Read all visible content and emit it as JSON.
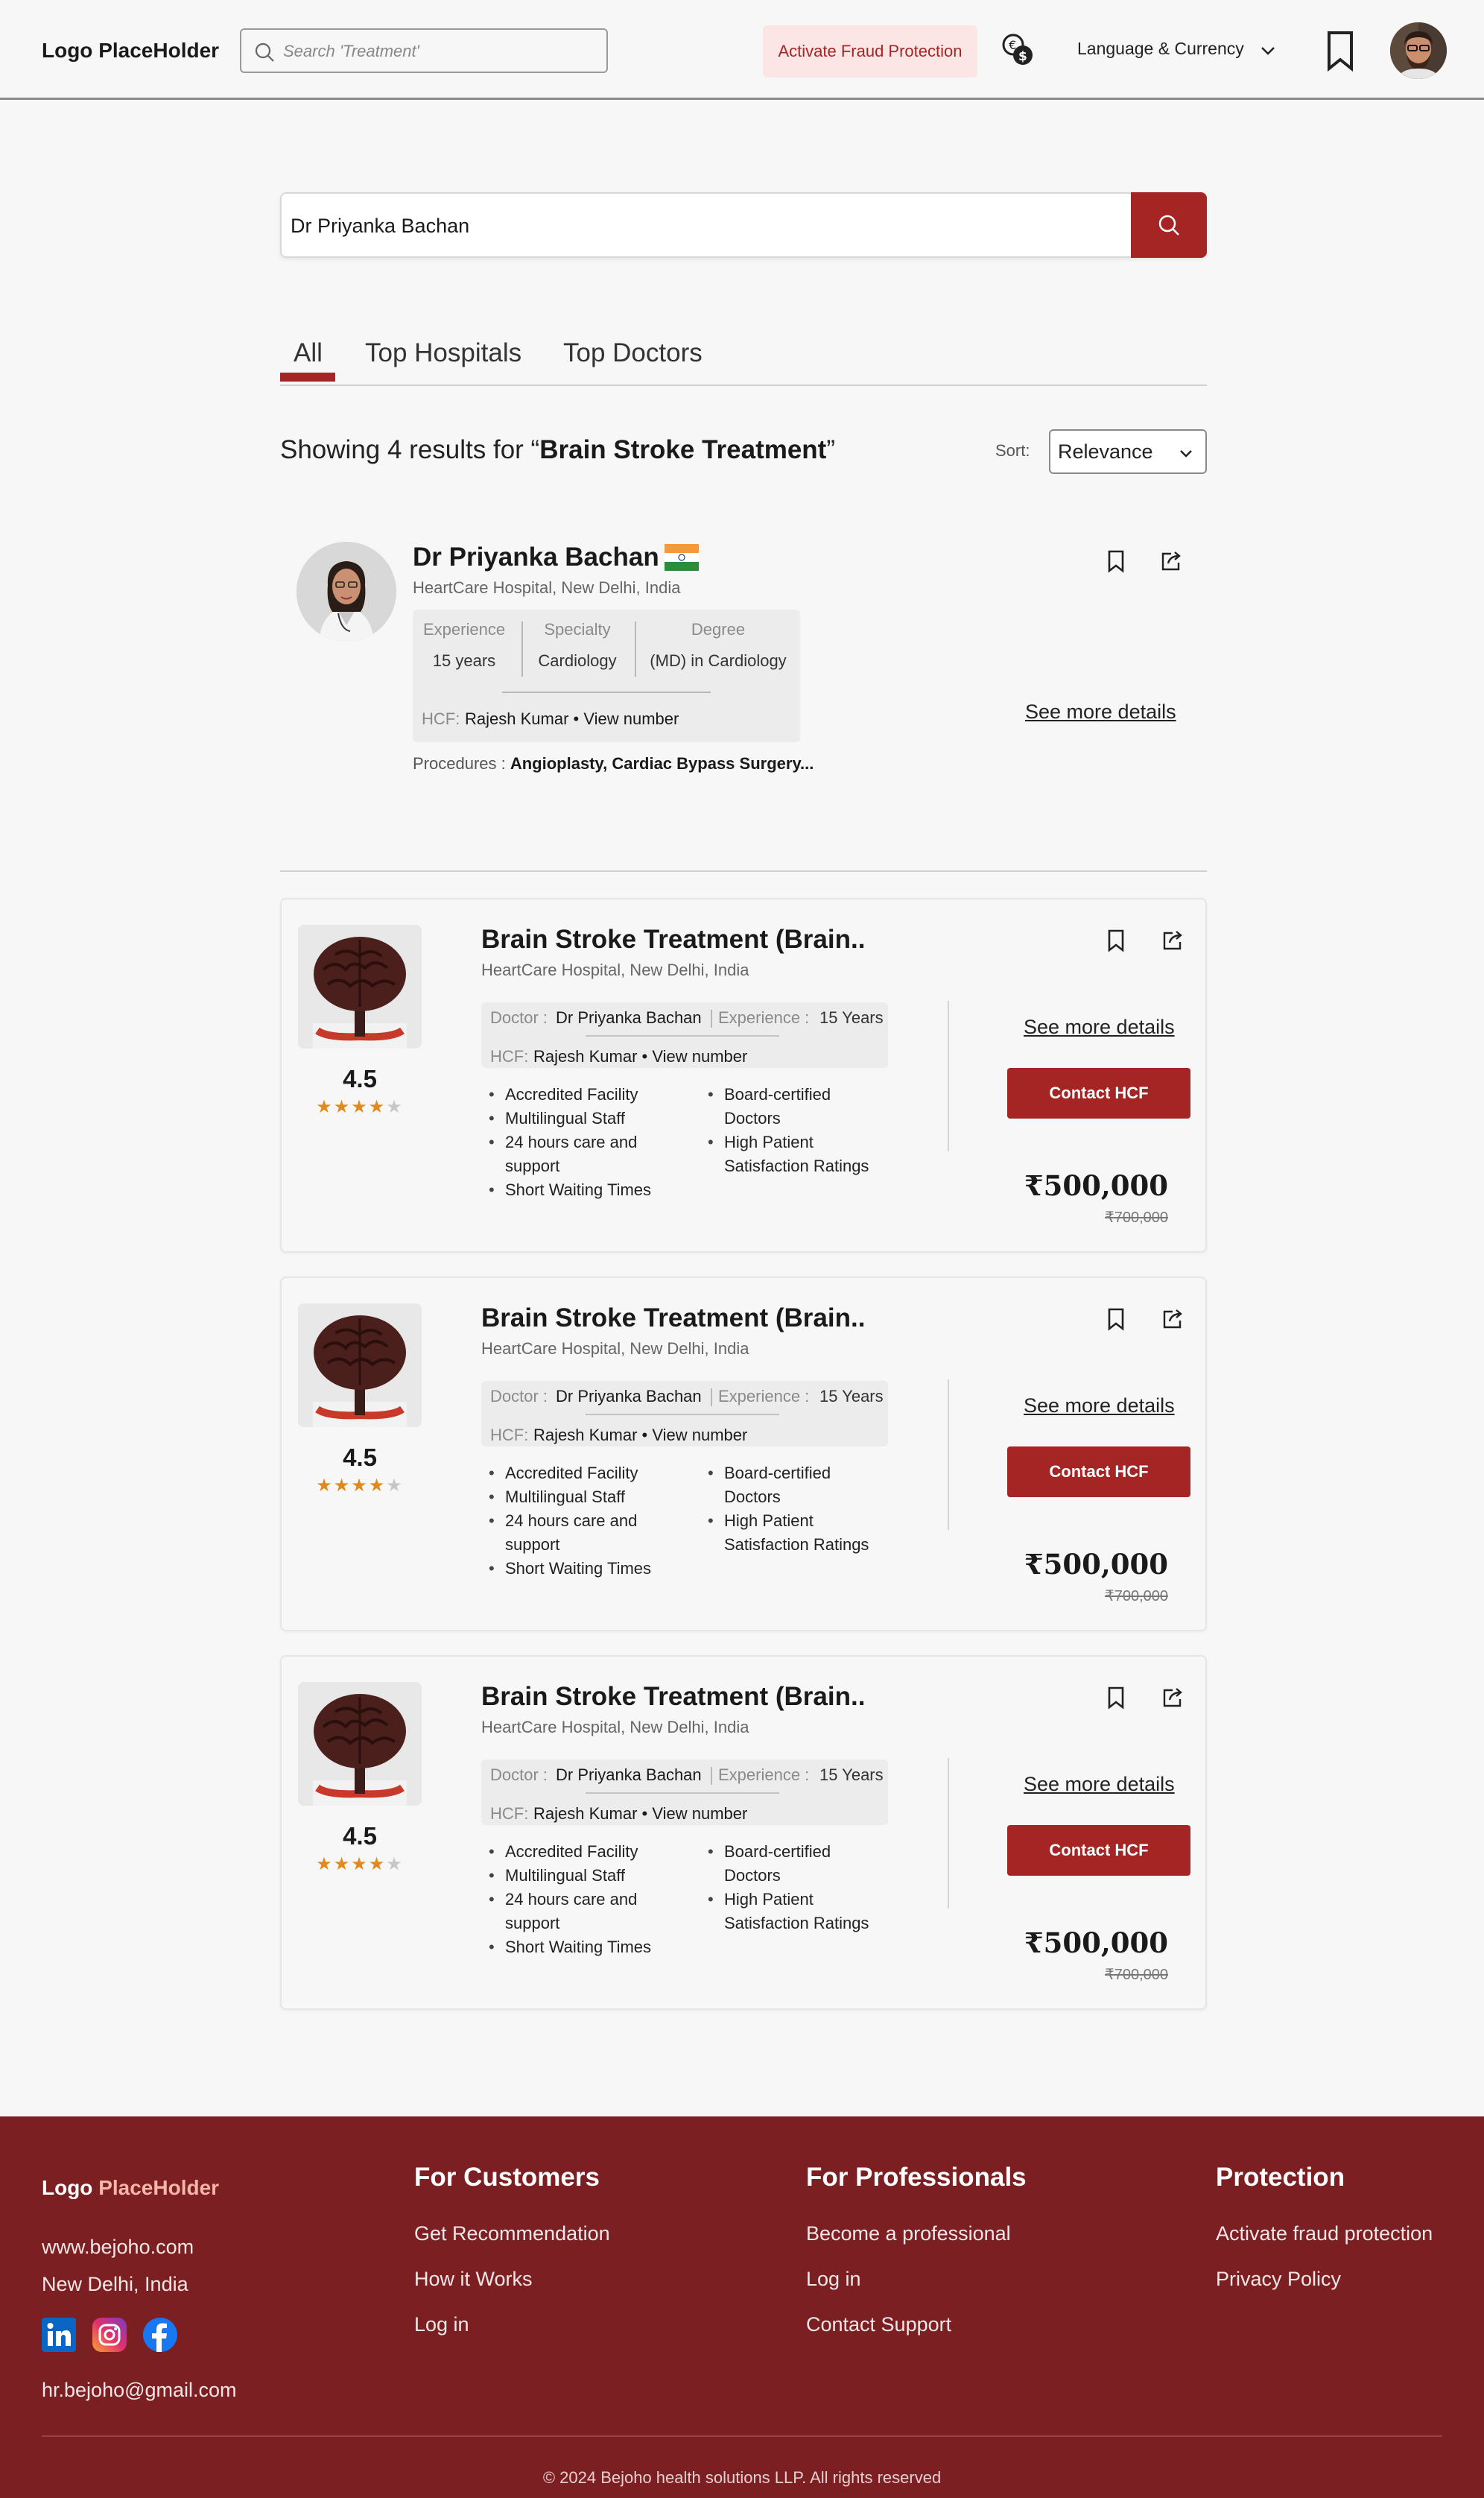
{
  "header": {
    "logo": "Logo PlaceHolder",
    "search_placeholder": "Search 'Treatment'",
    "fraud_button": "Activate Fraud Protection",
    "language_currency": "Language & Currency"
  },
  "search": {
    "value": "Dr Priyanka Bachan"
  },
  "tabs": [
    {
      "label": "All",
      "active": true
    },
    {
      "label": "Top Hospitals",
      "active": false
    },
    {
      "label": "Top Doctors",
      "active": false
    }
  ],
  "results": {
    "prefix": "Showing 4 results for “",
    "query": "Brain Stroke Treatment",
    "suffix": "”",
    "sort_label": "Sort:",
    "sort_value": "Relevance"
  },
  "doctor": {
    "name": "Dr Priyanka Bachan",
    "hospital": "HeartCare Hospital, New Delhi, India",
    "experience_label": "Experience",
    "experience_value": "15 years",
    "specialty_label": "Specialty",
    "specialty_value": "Cardiology",
    "degree_label": "Degree",
    "degree_value": "(MD) in Cardiology",
    "hcf_label": "HCF:",
    "hcf_value": "Rajesh Kumar • View number",
    "procedures_label": "Procedures : ",
    "procedures_value": "Angioplasty, Cardiac Bypass Surgery...",
    "see_more": "See more details"
  },
  "treatments": [
    {
      "title": "Brain Stroke Treatment (Brain..",
      "hospital": "HeartCare Hospital, New Delhi, India",
      "rating": "4.5",
      "stars": 4,
      "doctor_label": "Doctor :",
      "doctor_value": "Dr Priyanka Bachan",
      "experience_label": "Experience :",
      "experience_value": "15 Years",
      "hcf_label": "HCF:",
      "hcf_value": "Rajesh Kumar • View number",
      "features_left": [
        "Accredited Facility",
        "Multilingual Staff",
        "24 hours care and support",
        "Short Waiting Times"
      ],
      "features_right": [
        "Board-certified Doctors",
        "High Patient Satisfaction Ratings"
      ],
      "see_more": "See more details",
      "contact": "Contact HCF",
      "price": "₹500,000",
      "old_price": "₹700,000"
    },
    {
      "title": "Brain Stroke Treatment (Brain..",
      "hospital": "HeartCare Hospital, New Delhi, India",
      "rating": "4.5",
      "stars": 4,
      "doctor_label": "Doctor :",
      "doctor_value": "Dr Priyanka Bachan",
      "experience_label": "Experience :",
      "experience_value": "15 Years",
      "hcf_label": "HCF:",
      "hcf_value": "Rajesh Kumar • View number",
      "features_left": [
        "Accredited Facility",
        "Multilingual Staff",
        "24 hours care and support",
        "Short Waiting Times"
      ],
      "features_right": [
        "Board-certified Doctors",
        "High Patient Satisfaction Ratings"
      ],
      "see_more": "See more details",
      "contact": "Contact HCF",
      "price": "₹500,000",
      "old_price": "₹700,000"
    },
    {
      "title": "Brain Stroke Treatment (Brain..",
      "hospital": "HeartCare Hospital, New Delhi, India",
      "rating": "4.5",
      "stars": 4,
      "doctor_label": "Doctor :",
      "doctor_value": "Dr Priyanka Bachan",
      "experience_label": "Experience :",
      "experience_value": "15 Years",
      "hcf_label": "HCF:",
      "hcf_value": "Rajesh Kumar • View number",
      "features_left": [
        "Accredited Facility",
        "Multilingual Staff",
        "24 hours care and support",
        "Short Waiting Times"
      ],
      "features_right": [
        "Board-certified Doctors",
        "High Patient Satisfaction Ratings"
      ],
      "see_more": "See more details",
      "contact": "Contact HCF",
      "price": "₹500,000",
      "old_price": "₹700,000"
    }
  ],
  "footer": {
    "logo_a": "Logo ",
    "logo_b": "PlaceHolder",
    "website": "www.bejoho.com",
    "location": "New Delhi, India",
    "email": "hr.bejoho@gmail.com",
    "social": [
      "linkedin-icon",
      "instagram-icon",
      "facebook-icon"
    ],
    "customers_title": "For Customers",
    "customers_links": [
      "Get Recommendation",
      "How it Works",
      "Log in"
    ],
    "professionals_title": "For Professionals",
    "professionals_links": [
      "Become a professional",
      "Log in",
      "Contact Support"
    ],
    "protection_title": "Protection",
    "protection_links": [
      "Activate fraud protection",
      "Privacy Policy"
    ],
    "copyright": "© 2024 Bejoho health solutions LLP. All rights reserved"
  },
  "colors": {
    "accent": "#a52424",
    "footer_bg": "#7c1f22",
    "star": "#e08a1e",
    "page_bg": "#f7f7f7"
  }
}
